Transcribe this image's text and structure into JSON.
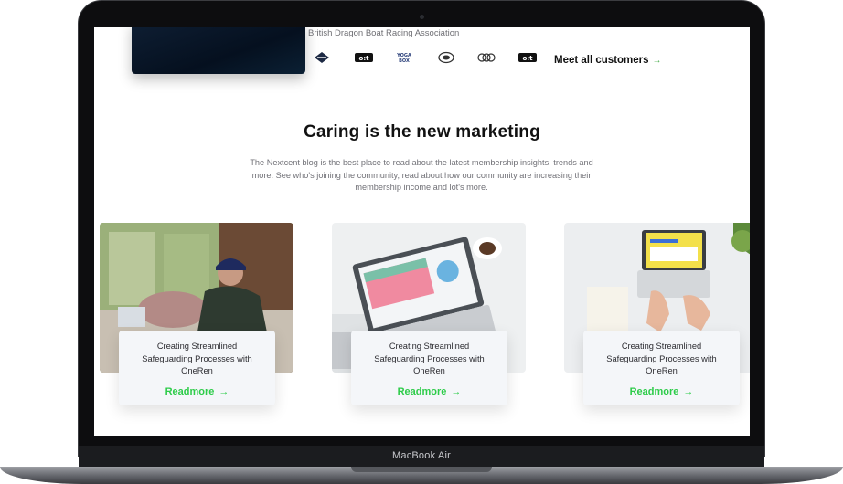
{
  "device": {
    "model_label": "MacBook Air"
  },
  "header": {
    "association_text": "British Dragon Boat Racing Association",
    "customer_logos": [
      "emblem-logo",
      "odt-logo",
      "yoga-logo",
      "badge-logo",
      "loops-logo",
      "odt-logo"
    ],
    "meet_link": "Meet all customers",
    "meet_arrow": "→"
  },
  "blog": {
    "title": "Caring is the new marketing",
    "description": "The Nextcent blog is the best place to read about the latest membership insights, trends and more. See who's joining the community, read about how our community are increasing their membership income and lot's more.",
    "cards": [
      {
        "title": "Creating Streamlined Safeguarding Processes with OneRen",
        "link": "Readmore",
        "image": "woman-on-sofa-with-laptop"
      },
      {
        "title": "Creating Streamlined Safeguarding Processes with OneRen",
        "link": "Readmore",
        "image": "laptop-with-charts"
      },
      {
        "title": "Creating Streamlined Safeguarding Processes with OneRen",
        "link": "Readmore",
        "image": "hands-on-laptop"
      }
    ],
    "arrow": "→"
  },
  "colors": {
    "accent": "#2ecc4a",
    "heading": "#111111",
    "body_text": "#717177",
    "card_bg": "#f4f6f9"
  }
}
